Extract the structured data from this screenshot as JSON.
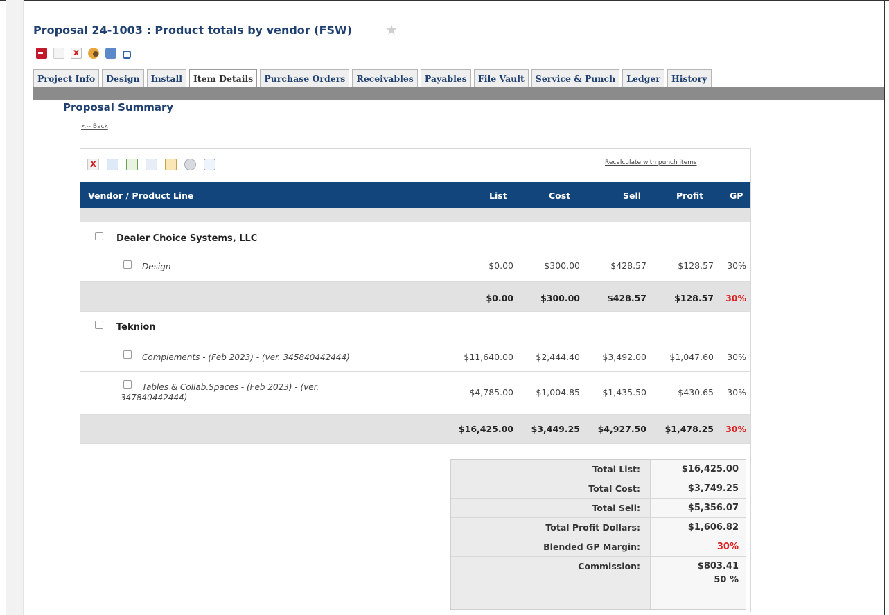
{
  "page": {
    "title": "Proposal 24-1003 : Product totals by vendor (FSW)"
  },
  "tabs": [
    {
      "label": "Project Info"
    },
    {
      "label": "Design"
    },
    {
      "label": "Install"
    },
    {
      "label": "Item Details"
    },
    {
      "label": "Purchase Orders"
    },
    {
      "label": "Receivables"
    },
    {
      "label": "Payables"
    },
    {
      "label": "File Vault"
    },
    {
      "label": "Service & Punch"
    },
    {
      "label": "Ledger"
    },
    {
      "label": "History"
    }
  ],
  "active_tab": "Item Details",
  "section": {
    "title": "Proposal Summary",
    "back_label": "<-- Back"
  },
  "panel": {
    "recalc_label": "Recalculate with punch items"
  },
  "grid": {
    "columns": [
      "Vendor / Product Line",
      "List",
      "Cost",
      "Sell",
      "Profit",
      "GP"
    ],
    "vendors": [
      {
        "name": "Dealer Choice Systems, LLC",
        "lines": [
          {
            "name": "Design",
            "list": "$0.00",
            "cost": "$300.00",
            "sell": "$428.57",
            "profit": "$128.57",
            "gp": "30%"
          }
        ],
        "subtotal": {
          "list": "$0.00",
          "cost": "$300.00",
          "sell": "$428.57",
          "profit": "$128.57",
          "gp": "30%"
        }
      },
      {
        "name": "Teknion",
        "lines": [
          {
            "name": "Complements - (Feb 2023) - (ver. 345840442444)",
            "list": "$11,640.00",
            "cost": "$2,444.40",
            "sell": "$3,492.00",
            "profit": "$1,047.60",
            "gp": "30%"
          },
          {
            "name": "Tables & Collab.Spaces - (Feb 2023) - (ver. 347840442444)",
            "list": "$4,785.00",
            "cost": "$1,004.85",
            "sell": "$1,435.50",
            "profit": "$430.65",
            "gp": "30%"
          }
        ],
        "subtotal": {
          "list": "$16,425.00",
          "cost": "$3,449.25",
          "sell": "$4,927.50",
          "profit": "$1,478.25",
          "gp": "30%"
        }
      }
    ]
  },
  "summary": [
    {
      "label": "Total List:",
      "value": "$16,425.00"
    },
    {
      "label": "Total Cost:",
      "value": "$3,749.25"
    },
    {
      "label": "Total Sell:",
      "value": "$5,356.07"
    },
    {
      "label": "Total Profit Dollars:",
      "value": "$1,606.82"
    },
    {
      "label": "Blended GP Margin:",
      "value": "30%"
    },
    {
      "label": "Commission:",
      "value": "$803.41",
      "value2": "50 %"
    }
  ],
  "colors": {
    "header_bg": "#12457c",
    "title": "#1f3f6e",
    "gp_highlight": "#e02020"
  },
  "icons": [
    "exit-icon",
    "new-document-icon",
    "delete-document-icon",
    "contacts-icon",
    "print-icon",
    "lock-icon",
    "pdf-icon",
    "tree-icon",
    "export-icon",
    "hierarchy-icon",
    "tag-icon",
    "save-icon",
    "search-icon"
  ]
}
